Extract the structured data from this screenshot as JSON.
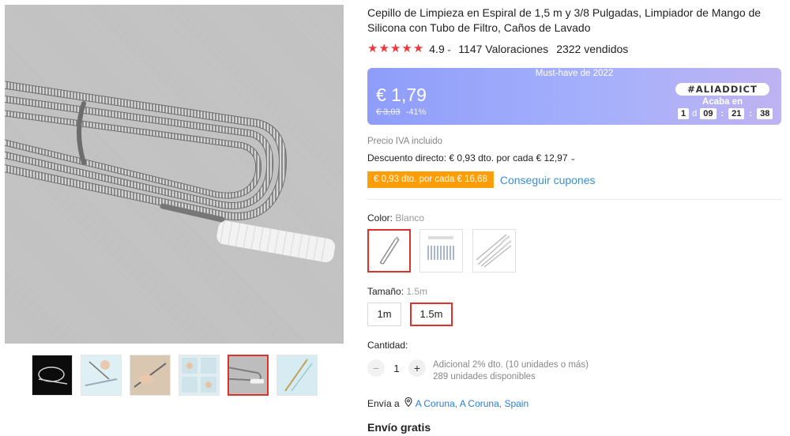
{
  "product": {
    "title": "Cepillo de Limpieza en Espiral de 1,5 m y 3/8 Pulgadas, Limpiador de Mango de Silicona con Tubo de Filtro, Caños de Lavado"
  },
  "rating": {
    "stars": 5,
    "value": "4.9",
    "reviews": "1147 Valoraciones",
    "sold": "2322 vendidos"
  },
  "promo": {
    "banner_label": "Must-have de 2022",
    "price": "€ 1,79",
    "original_price": "€ 3,03",
    "discount": "-41%",
    "tag": "#ALIADDICT",
    "ends_label": "Acaba en",
    "countdown": {
      "days": "1",
      "days_unit": "d",
      "hours": "09",
      "minutes": "21",
      "seconds": "38"
    }
  },
  "pricing": {
    "vat_note": "Precio IVA incluido",
    "direct_discount": "Descuento directo: € 0,93 dto. por cada € 12,97",
    "coupon": "€ 0,93 dto. por cada € 16,68",
    "coupon_link": "Conseguir cupones"
  },
  "color": {
    "label": "Color:",
    "selected": "Blanco",
    "options": [
      "Blanco",
      "Option 2",
      "Option 3"
    ]
  },
  "size": {
    "label": "Tamaño:",
    "selected": "1.5m",
    "options": [
      "1m",
      "1.5m"
    ]
  },
  "quantity": {
    "label": "Cantidad:",
    "minus": "−",
    "value": "1",
    "plus": "+",
    "bulk_discount": "Adicional 2% dto. (10 unidades o más)",
    "available": "289 unidades disponibles"
  },
  "shipping": {
    "label": "Envía a",
    "location": "A Coruna, A Coruna, Spain",
    "free": "Envío gratis"
  },
  "gallery": {
    "thumbnail_count": 6,
    "active_index": 4
  },
  "colors": {
    "star": "#f0383c",
    "accent_red": "#e0302c",
    "coupon_orange": "#fd9e08",
    "link_blue": "#3a8ed2",
    "banner_start": "#8e9dfa",
    "banner_end": "#bfb3f2"
  }
}
